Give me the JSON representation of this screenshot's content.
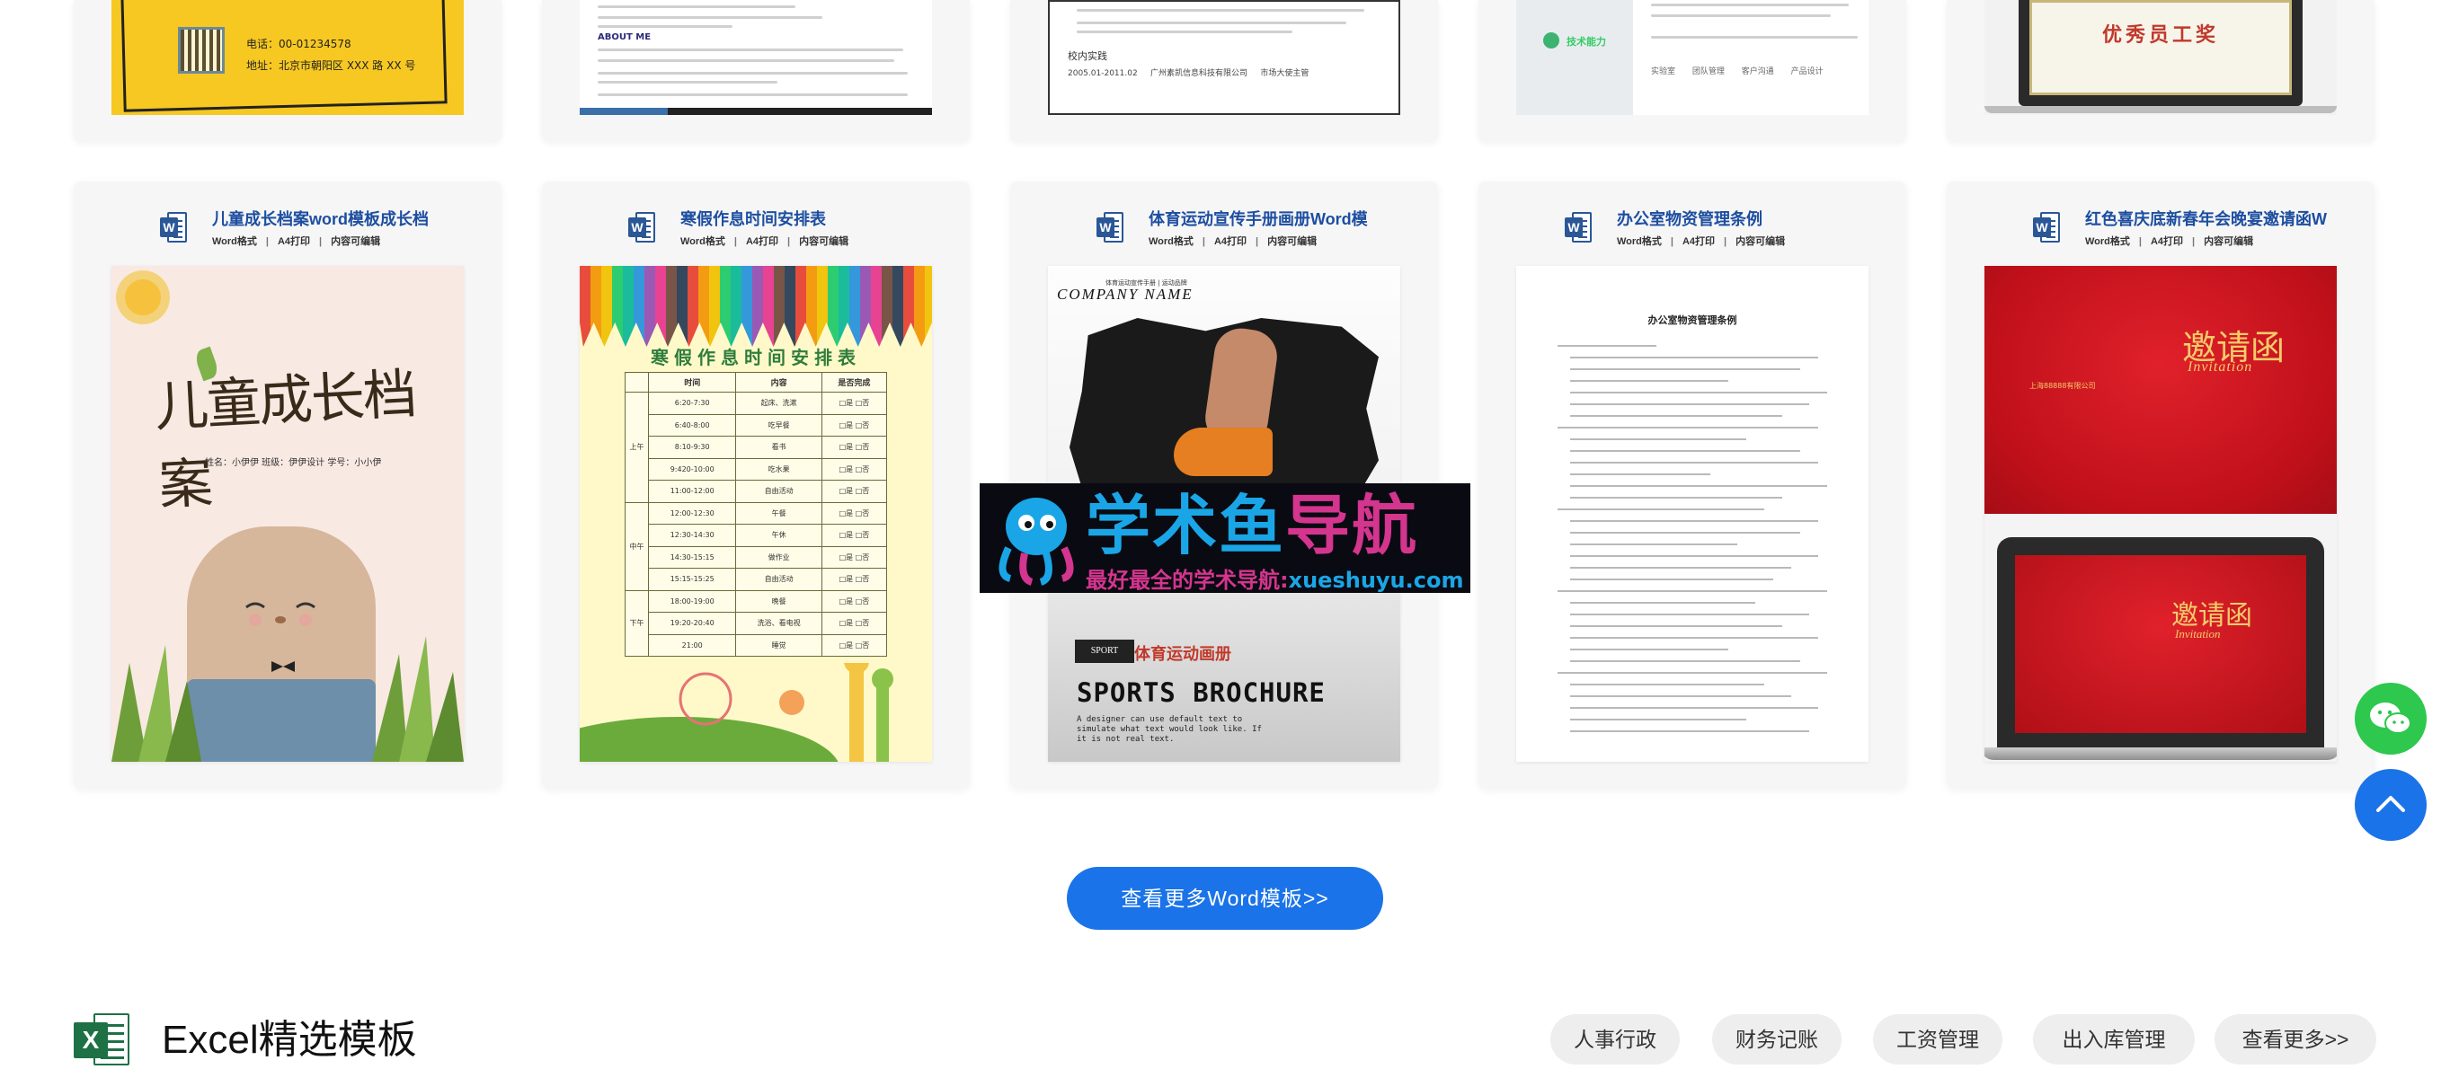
{
  "top_row": {
    "card1": {
      "phone": "电话：00-01234578",
      "address": "地址：北京市朝阳区 XXX 路 XX 号"
    },
    "card2": {
      "heading": "ABOUT ME"
    },
    "card3": {
      "section": "校内实践",
      "row_date": "2005.01-2011.02",
      "row_company": "广州素凯信息科技有限公司",
      "row_role": "市场大使主管"
    },
    "card4": {
      "skill": "技术能力",
      "footer": "实验室  团队管理  客户沟通  产品设计"
    },
    "card5": {
      "certificate": "优秀员工奖"
    }
  },
  "cards": [
    {
      "title": "儿童成长档案word模板成长档",
      "meta": [
        "Word格式",
        "A4打印",
        "内容可编辑"
      ],
      "poster_title": "儿童成长档案",
      "poster_info": "姓名：小伊伊 班级：伊伊设计 学号：小小伊"
    },
    {
      "title": "寒假作息时间安排表",
      "meta": [
        "Word格式",
        "A4打印",
        "内容可编辑"
      ],
      "poster_title": "寒假作息时间安排表",
      "columns": [
        "时间",
        "内容",
        "是否完成"
      ],
      "rows": [
        [
          "6:20-7:30",
          "起床、洗漱"
        ],
        [
          "6:40-8:00",
          "吃早餐"
        ],
        [
          "8:10-9:30",
          "看书"
        ],
        [
          "9:420-10:00",
          "吃水果"
        ],
        [
          "11:00-12:00",
          "自由活动"
        ],
        [
          "12:00-12:30",
          "午餐"
        ],
        [
          "12:30-14:30",
          "午休"
        ],
        [
          "14:30-15:15",
          "做作业"
        ],
        [
          "15:15-15:25",
          "自由活动"
        ],
        [
          "18:00-19:00",
          "晚餐"
        ],
        [
          "19:20-20:40",
          "洗浴、看电视"
        ],
        [
          "21:00",
          "睡觉"
        ]
      ],
      "done_option": "□是 □否",
      "period_labels": [
        "上午",
        "中午",
        "下午"
      ]
    },
    {
      "title": "体育运动宣传手册画册Word模",
      "meta": [
        "Word格式",
        "A4打印",
        "内容可编辑"
      ],
      "company": "COMPANY NAME",
      "company_sub": "体育运动宣传手册 | 运动品牌",
      "tag": "SPORT",
      "cn_title": "体育运动画册",
      "en_title": "SPORTS BROCHURE",
      "desc": "A designer can use default text to simulate what text would look like. If it is not real text."
    },
    {
      "title": "办公室物资管理条例",
      "meta": [
        "Word格式",
        "A4打印",
        "内容可编辑"
      ],
      "doc_title": "办公室物资管理条例"
    },
    {
      "title": "红色喜庆底新春年会晚宴邀请函W",
      "meta": [
        "Word格式",
        "A4打印",
        "内容可编辑"
      ],
      "inv_title": "邀请函",
      "inv_en": "Invitation",
      "inv_company": "上海88888有限公司"
    }
  ],
  "watermark": {
    "big_1": "学术鱼",
    "big_2": "导航",
    "small_1": "最好最全的学术导航:",
    "small_2": "xueshuyu.com"
  },
  "view_more_label": "查看更多Word模板>>",
  "excel_section": {
    "icon_letter": "X",
    "title": "Excel精选模板",
    "tags": [
      "人事行政",
      "财务记账",
      "工资管理",
      "出入库管理",
      "查看更多>>"
    ]
  },
  "float": {
    "wechat": "wechat-icon",
    "top": "arrow-up-icon"
  },
  "colors": {
    "accent": "#1a73e8",
    "word_blue": "#2b5797",
    "excel_green": "#1e7145",
    "wechat_green": "#2dc84d"
  }
}
